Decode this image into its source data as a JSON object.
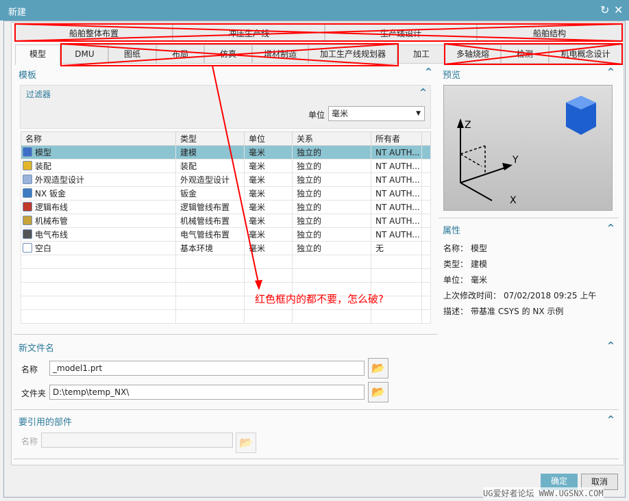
{
  "window": {
    "title": "新建"
  },
  "tabs_row1": [
    "船舶整体布置",
    "冲压生产线",
    "生产线设计",
    "船舶结构"
  ],
  "tabs_row2": [
    "模型",
    "DMU",
    "图纸",
    "布局",
    "仿真",
    "增材制造",
    "加工生产线规划器",
    "加工",
    "多轴烧熔",
    "检测",
    "机电概念设计"
  ],
  "template": {
    "title": "模板",
    "filter_title": "过滤器",
    "unit_label": "单位",
    "unit_value": "毫米",
    "columns": [
      "名称",
      "类型",
      "单位",
      "关系",
      "所有者"
    ],
    "rows": [
      [
        "模型",
        "建模",
        "毫米",
        "独立的",
        "NT AUTH..."
      ],
      [
        "装配",
        "装配",
        "毫米",
        "独立的",
        "NT AUTH..."
      ],
      [
        "外观造型设计",
        "外观造型设计",
        "毫米",
        "独立的",
        "NT AUTH..."
      ],
      [
        "NX 钣金",
        "钣金",
        "毫米",
        "独立的",
        "NT AUTH..."
      ],
      [
        "逻辑布线",
        "逻辑管线布置",
        "毫米",
        "独立的",
        "NT AUTH..."
      ],
      [
        "机械布管",
        "机械管线布置",
        "毫米",
        "独立的",
        "NT AUTH..."
      ],
      [
        "电气布线",
        "电气管线布置",
        "毫米",
        "独立的",
        "NT AUTH..."
      ],
      [
        "空白",
        "基本环境",
        "毫米",
        "独立的",
        "无"
      ]
    ]
  },
  "preview": {
    "title": "预览",
    "axes": [
      "Z",
      "Y",
      "X"
    ]
  },
  "properties": {
    "title": "属性",
    "items": [
      {
        "k": "名称：",
        "v": "模型"
      },
      {
        "k": "类型：",
        "v": "建模"
      },
      {
        "k": "单位：",
        "v": "毫米"
      },
      {
        "k": "上次修改时间：",
        "v": "07/02/2018 09:25 上午"
      },
      {
        "k": "描述：",
        "v": "带基准 CSYS 的 NX 示例"
      }
    ]
  },
  "new_file": {
    "title": "新文件名",
    "name_label": "名称",
    "name_value": "_model1.prt",
    "folder_label": "文件夹",
    "folder_value": "D:\\temp\\temp_NX\\"
  },
  "ref_part": {
    "title": "要引用的部件",
    "name_label": "名称",
    "name_value": ""
  },
  "buttons": {
    "ok": "确定",
    "cancel": "取消"
  },
  "annotation": "红色框内的都不要，怎么破?",
  "watermark": "UG爱好者论坛 WWW.UGSNX.COM",
  "colors": {
    "titlebar": "#5aa0bb",
    "accent": "#2b7a9a",
    "selected_row": "#8cc4d2",
    "annotation": "#ff0000"
  }
}
